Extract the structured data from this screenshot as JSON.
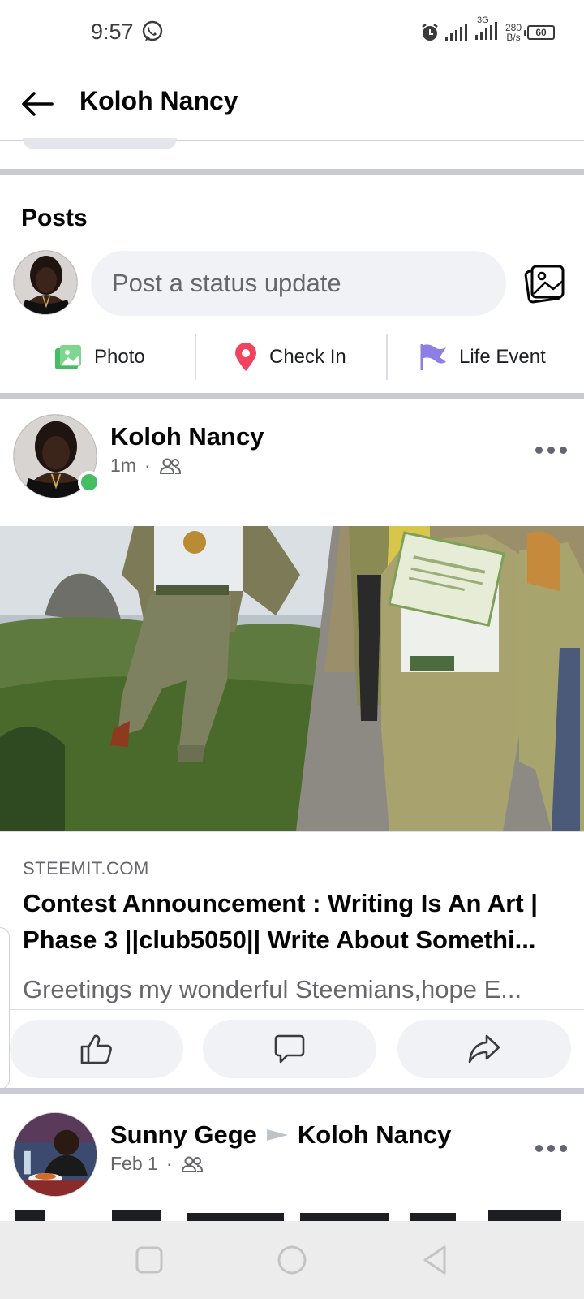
{
  "status_bar": {
    "time": "9:57",
    "network_type": "3G",
    "speed_value": "280",
    "speed_unit": "B/s",
    "battery": "60",
    "icons": [
      "whatsapp-icon",
      "alarm-icon",
      "signal-icon",
      "signal-icon",
      "battery-icon"
    ]
  },
  "header": {
    "title": "Koloh Nancy",
    "back_icon": "arrow-left-icon"
  },
  "posts_section": {
    "title": "Posts",
    "composer_placeholder": "Post a status update",
    "gallery_icon": "photo-gallery-icon",
    "actions": [
      {
        "label": "Photo",
        "icon": "photo-icon",
        "color": "#45bd62"
      },
      {
        "label": "Check In",
        "icon": "location-pin-icon",
        "color": "#f3425f"
      },
      {
        "label": "Life Event",
        "icon": "flag-icon",
        "color": "#8c7ee7"
      }
    ]
  },
  "post": {
    "author": "Koloh Nancy",
    "time": "1m",
    "audience_icon": "friends-icon",
    "online": true,
    "more_icon": "more-horizontal-icon",
    "link": {
      "domain": "STEEMIT.COM",
      "title_line1": "Contest Announcement : Writing Is An Art |",
      "title_line2": "Phase 3 ||club5050|| Write About Somethi...",
      "description": "Greetings my wonderful Steemians,hope E..."
    },
    "reactions": [
      {
        "icon": "like-icon"
      },
      {
        "icon": "comment-icon"
      },
      {
        "icon": "share-icon"
      }
    ]
  },
  "next_post": {
    "author": "Sunny Gege",
    "target": "Koloh Nancy",
    "time": "Feb 1",
    "audience_icon": "friends-icon",
    "more_icon": "more-horizontal-icon"
  },
  "nav_bar": {
    "icons": [
      "recents-square-icon",
      "home-circle-icon",
      "back-triangle-icon"
    ]
  },
  "colors": {
    "text_primary": "#050505",
    "text_secondary": "#65676b",
    "surface_grey": "#f0f2f5",
    "online_green": "#45bd62"
  }
}
